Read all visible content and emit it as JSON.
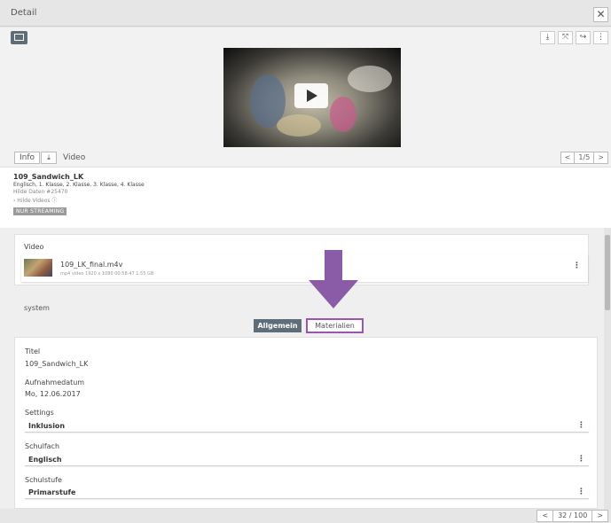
{
  "header": {
    "title": "Detail",
    "close_glyph": "✕"
  },
  "preview": {
    "tools": [
      "⤓",
      "⤧",
      "↪",
      "⋮"
    ],
    "tool_icons": [
      "download-icon",
      "fullscreen-icon",
      "share-icon",
      "more-icon"
    ]
  },
  "info_bar": {
    "info_label": "Info",
    "download_glyph": "⤓",
    "section": "Video",
    "pager_prev": "<",
    "pager_value": "1/5",
    "pager_next": ">"
  },
  "meta": {
    "name": "109_Sandwich_LK",
    "subjects": "Englisch, 1. Klasse, 2. Klasse, 3. Klasse, 4. Klasse",
    "hide_data": "Hilde Daten #25470",
    "hide_videos": "› Hilde Videos ⓘ",
    "badge": "NUR STREAMING"
  },
  "video_card": {
    "header": "Video",
    "file_name": "109_LK_final.m4v",
    "file_desc": "mp4 video 1920 x 1080 00:58:47 1.55 GB"
  },
  "system_label": "system",
  "tabs": {
    "general": "Allgemein",
    "materials": "Materialien"
  },
  "form": {
    "title_label": "Titel",
    "title_value": "109_Sandwich_LK",
    "date_label": "Aufnahmedatum",
    "date_value": "Mo, 12.06.2017",
    "settings_label": "Settings",
    "settings_value": "Inklusion",
    "subject_label": "Schulfach",
    "subject_value": "Englisch",
    "level_label": "Schulstufe",
    "level_value": "Primarstufe"
  },
  "footer": {
    "prev": "<",
    "page": "32 / 100",
    "next": ">"
  },
  "colors": {
    "accent": "#5f6d78",
    "highlight": "#9a55b4",
    "arrow": "#8a5ca8"
  }
}
